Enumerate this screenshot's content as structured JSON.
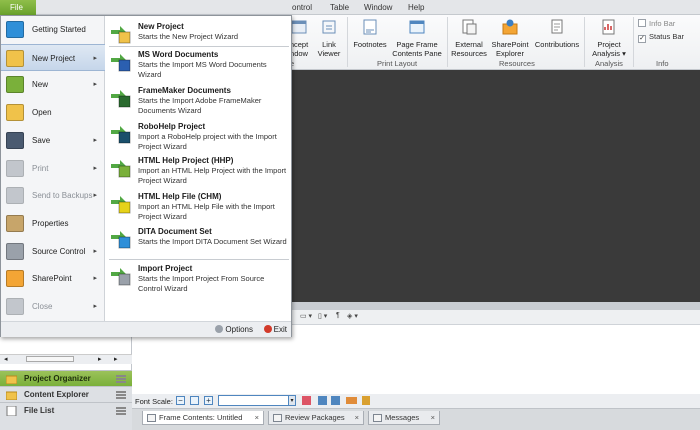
{
  "menubar": {
    "file_label": "File",
    "items": [
      "ontrol",
      "Table",
      "Window",
      "Help"
    ]
  },
  "ribbon": {
    "buttons": [
      {
        "label": "ncept\nndow"
      },
      {
        "label": "Link\nViewer"
      },
      {
        "label": "Footnotes"
      },
      {
        "label": "Page Frame\nContents Pane"
      },
      {
        "label": "External\nResources"
      },
      {
        "label": "SharePoint\nExplorer"
      },
      {
        "label": "Contributions"
      },
      {
        "label": "Project\nAnalysis ▾"
      }
    ],
    "groups": [
      "Print Layout",
      "Resources",
      "Analysis",
      "Info"
    ],
    "group_stub": "e",
    "checkboxes": [
      {
        "label": "Info Bar",
        "checked": false
      },
      {
        "label": "Status Bar",
        "checked": true
      }
    ]
  },
  "file_menu": {
    "left_items": [
      {
        "label": "Getting Started",
        "icon": "getting-started-icon",
        "disabled": false,
        "selected": false,
        "arrow": false
      },
      {
        "label": "New Project",
        "icon": "new-project-folder-icon",
        "disabled": false,
        "selected": true,
        "arrow": true
      },
      {
        "label": "New",
        "icon": "new-document-icon",
        "disabled": false,
        "selected": false,
        "arrow": true
      },
      {
        "label": "Open",
        "icon": "open-folder-icon",
        "disabled": false,
        "selected": false,
        "arrow": false
      },
      {
        "label": "Save",
        "icon": "save-disk-icon",
        "disabled": false,
        "selected": false,
        "arrow": true
      },
      {
        "label": "Print",
        "icon": "printer-icon",
        "disabled": true,
        "selected": false,
        "arrow": true
      },
      {
        "label": "Send to Backups",
        "icon": "send-backups-icon",
        "disabled": true,
        "selected": false,
        "arrow": true
      },
      {
        "label": "Properties",
        "icon": "properties-icon",
        "disabled": false,
        "selected": false,
        "arrow": false
      },
      {
        "label": "Source Control",
        "icon": "source-control-icon",
        "disabled": false,
        "selected": false,
        "arrow": true
      },
      {
        "label": "SharePoint",
        "icon": "sharepoint-icon",
        "disabled": false,
        "selected": false,
        "arrow": true
      },
      {
        "label": "Close",
        "icon": "close-icon",
        "disabled": true,
        "selected": false,
        "arrow": true
      }
    ],
    "submenu": [
      {
        "title": "New Project",
        "desc": "Starts the New Project Wizard",
        "icon": "new-project-folder-icon"
      },
      {
        "title": "MS Word Documents",
        "desc": "Starts the Import MS Word Documents Wizard",
        "icon": "word-import-icon"
      },
      {
        "title": "FrameMaker Documents",
        "desc": "Starts the Import Adobe FrameMaker Documents Wizard",
        "icon": "framemaker-import-icon"
      },
      {
        "title": "RoboHelp Project",
        "desc": "Import a RoboHelp project with the Import Project Wizard",
        "icon": "robohelp-import-icon"
      },
      {
        "title": "HTML Help Project (HHP)",
        "desc": "Import an HTML Help Project with the Import Project Wizard",
        "icon": "hhp-import-icon"
      },
      {
        "title": "HTML Help File (CHM)",
        "desc": "Import an HTML Help File with the Import Project Wizard",
        "icon": "chm-import-icon"
      },
      {
        "title": "DITA Document Set",
        "desc": "Starts the Import DITA Document Set Wizard",
        "icon": "dita-import-icon"
      },
      {
        "title": "Import Project",
        "desc": "Starts the Import Project From Source Control Wizard",
        "icon": "source-import-icon"
      }
    ],
    "footer": {
      "options": "Options",
      "exit": "Exit"
    }
  },
  "accordion": [
    {
      "label": "Project Organizer",
      "icon": "project-organizer-icon",
      "active": true
    },
    {
      "label": "Content Explorer",
      "icon": "content-explorer-icon",
      "active": false
    },
    {
      "label": "File List",
      "icon": "file-list-icon",
      "active": false
    }
  ],
  "font_scale": {
    "label": "Font Scale:"
  },
  "doc_tabs": [
    {
      "label": "Frame Contents: Untitled",
      "active": true
    },
    {
      "label": "Review Packages",
      "active": false
    },
    {
      "label": "Messages",
      "active": false
    }
  ],
  "colors": {
    "accent_green": "#7ab03a",
    "selection_blue": "#c6d6ea",
    "editor_dark": "#3a3a3a"
  }
}
